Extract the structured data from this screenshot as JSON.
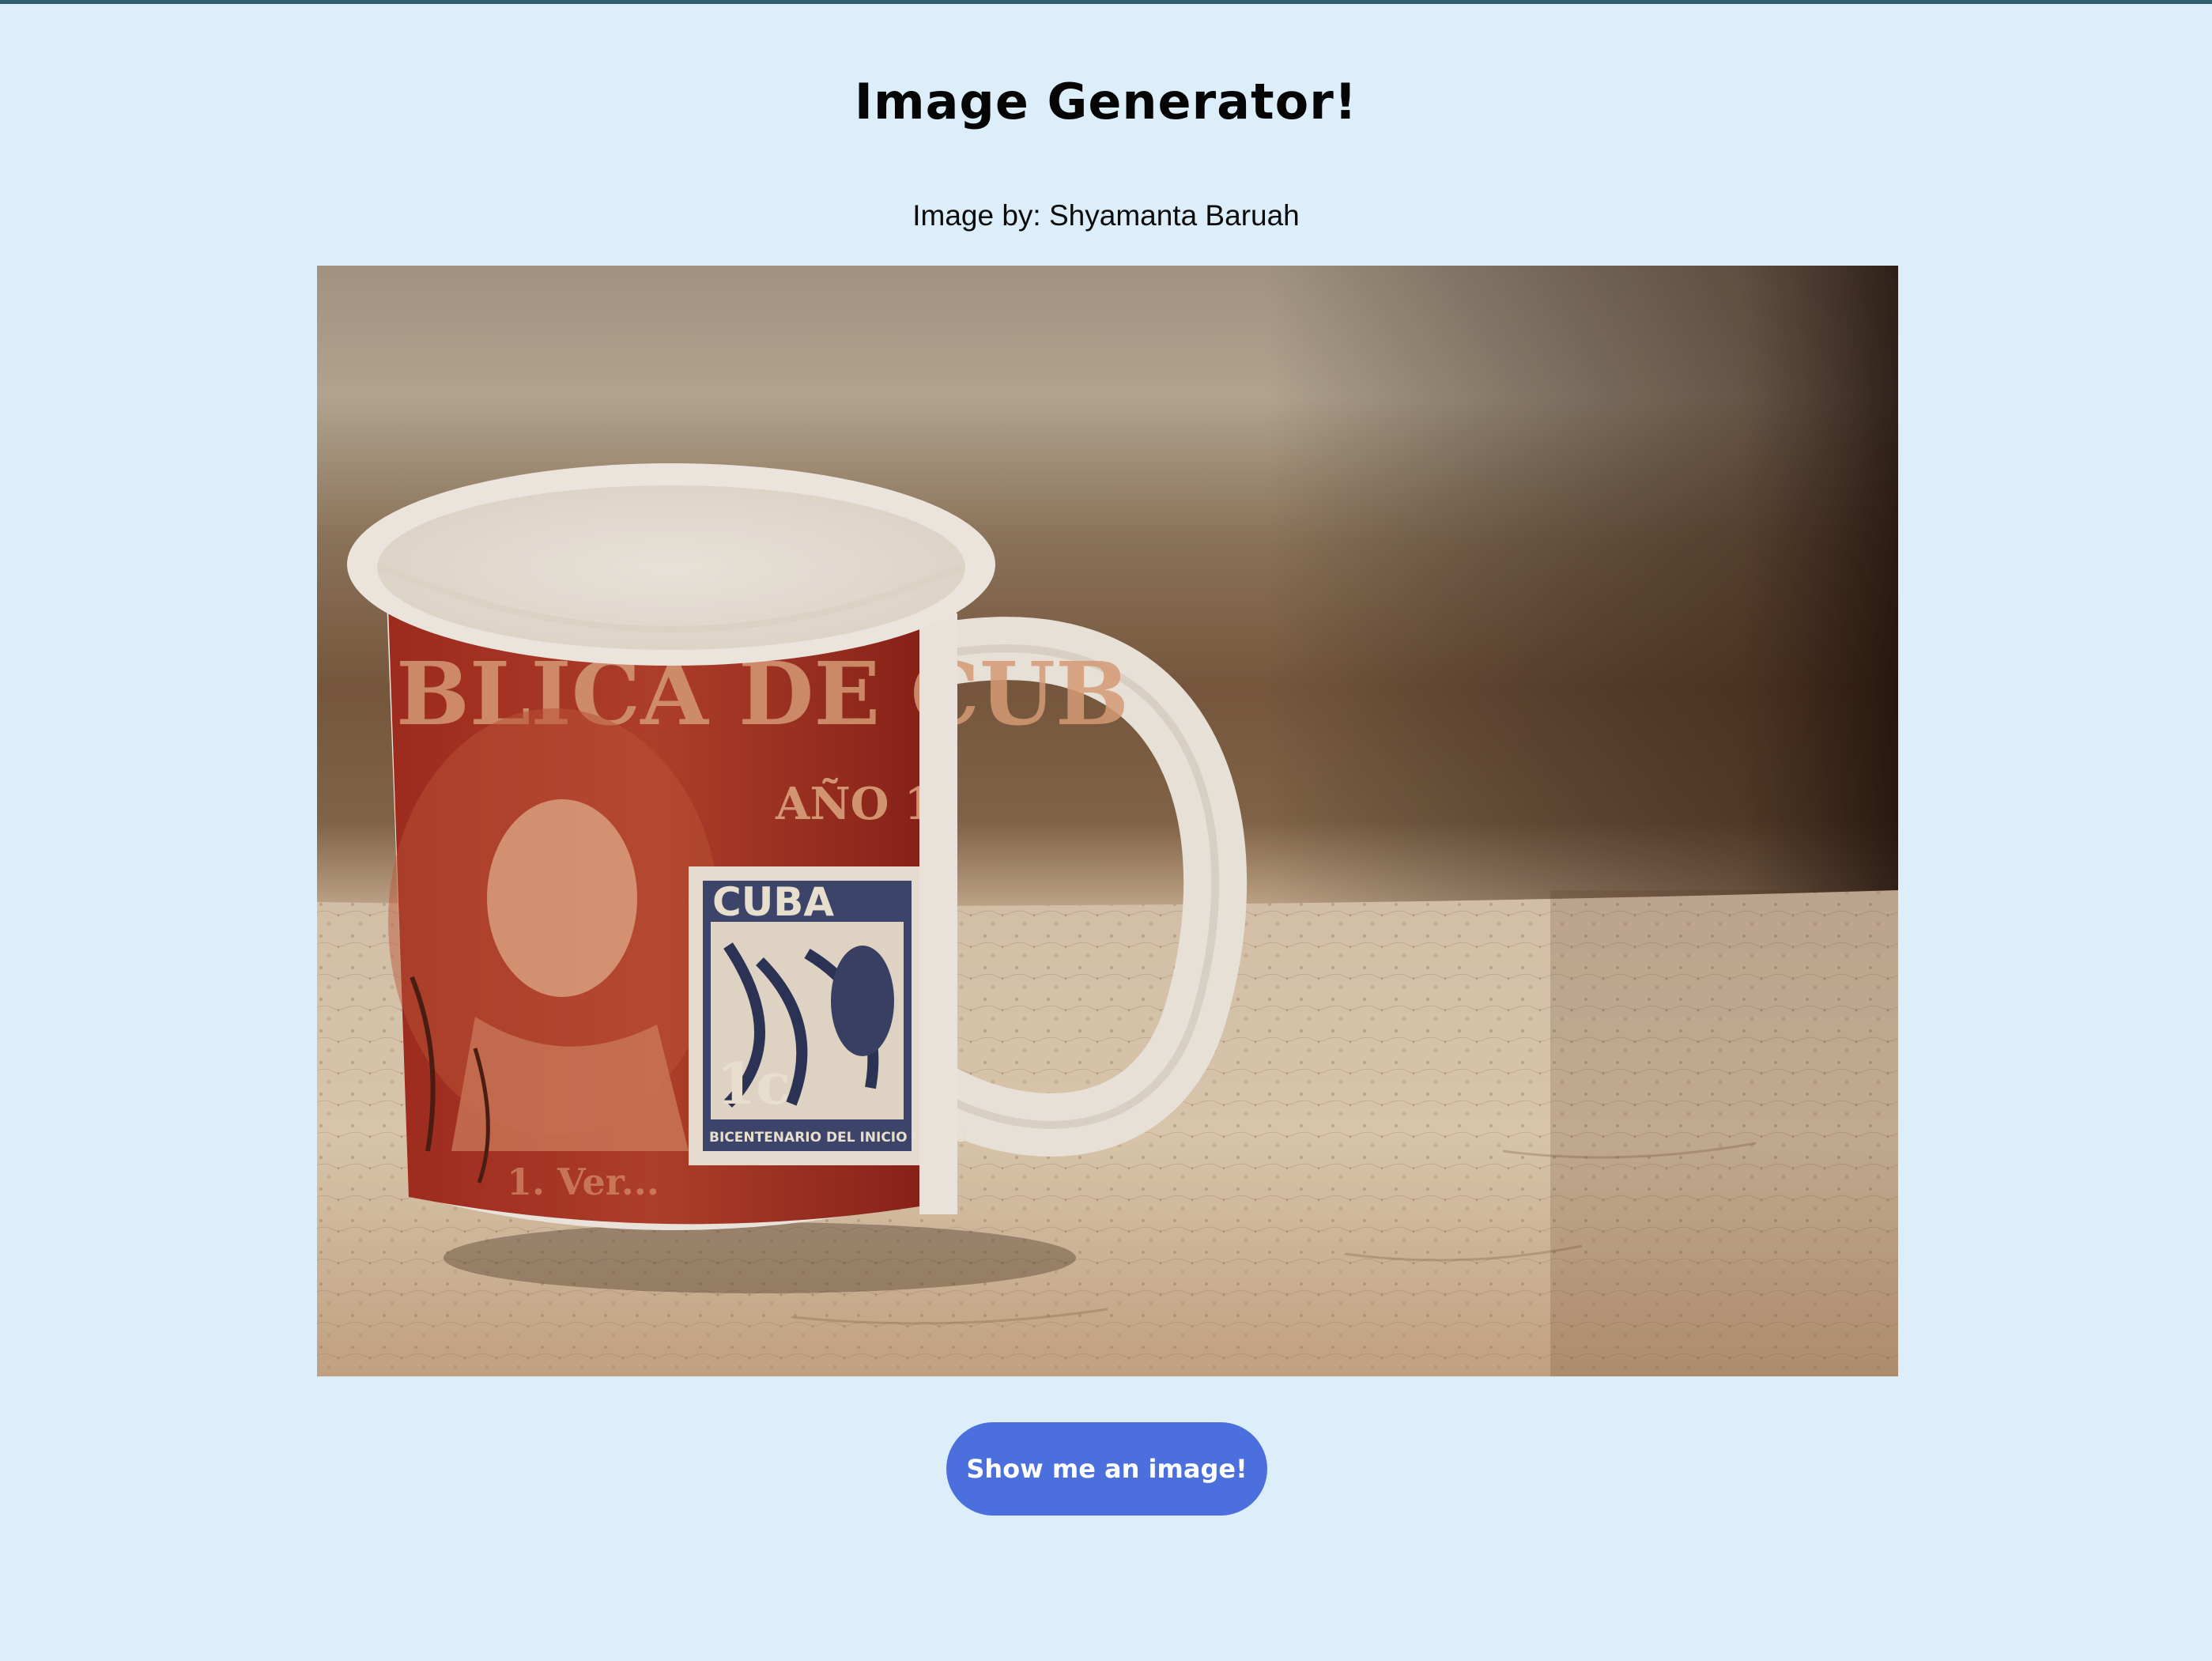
{
  "page": {
    "title": "Image Generator!",
    "credit": "Image by: Shyamanta Baruah",
    "button_label": "Show me an image!"
  },
  "photo": {
    "subject": "white coffee mug with red Cuba stamp print on a stone surface",
    "stamp_text": {
      "country": "CUBA",
      "denomination": "1c",
      "bottom_line": "BICENTENARIO DEL INICIO DEL CU",
      "banner": "BLICA DE CUB",
      "year_label": "AÑO 1"
    }
  },
  "colors": {
    "background": "#ddeefb",
    "top_border": "#2f5f6e",
    "button": "#4b6fdc",
    "button_text": "#ffffff",
    "title_text": "#050505"
  }
}
